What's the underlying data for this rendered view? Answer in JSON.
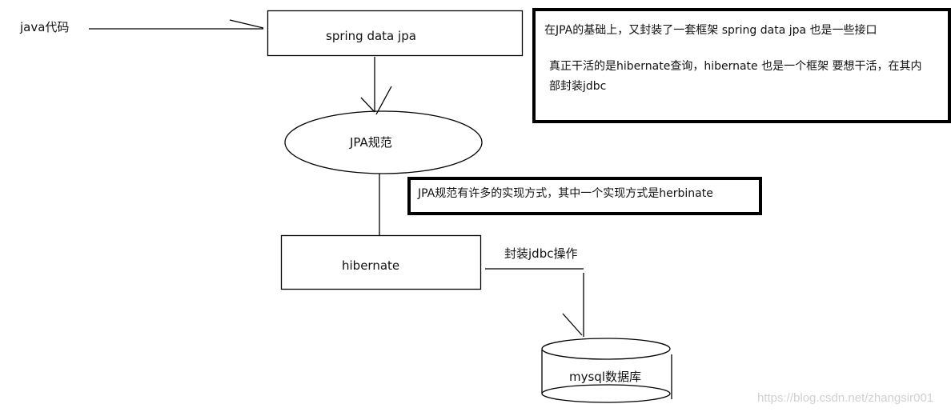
{
  "diagram": {
    "nodes": {
      "java_code": "java代码",
      "spring_data_jpa": "spring data  jpa",
      "jpa_spec": "JPA规范",
      "hibernate": "hibernate",
      "mysql": "mysql数据库"
    },
    "edge_labels": {
      "hibernate_to_mysql": "封装jdbc操作"
    },
    "notes": {
      "top_right": {
        "line1": "在JPA的基础上，又封装了一套框架  spring  data jpa    也是一些接口",
        "line2": "真正干活的是hibernate查询，hibernate 也是一个框架  要想干活，在其内",
        "line3": "部封装jdbc"
      },
      "middle": {
        "line1": "JPA规范有许多的实现方式，其中一个实现方式是herbinate"
      }
    },
    "watermark": "https://blog.csdn.net/zhangsir001"
  }
}
